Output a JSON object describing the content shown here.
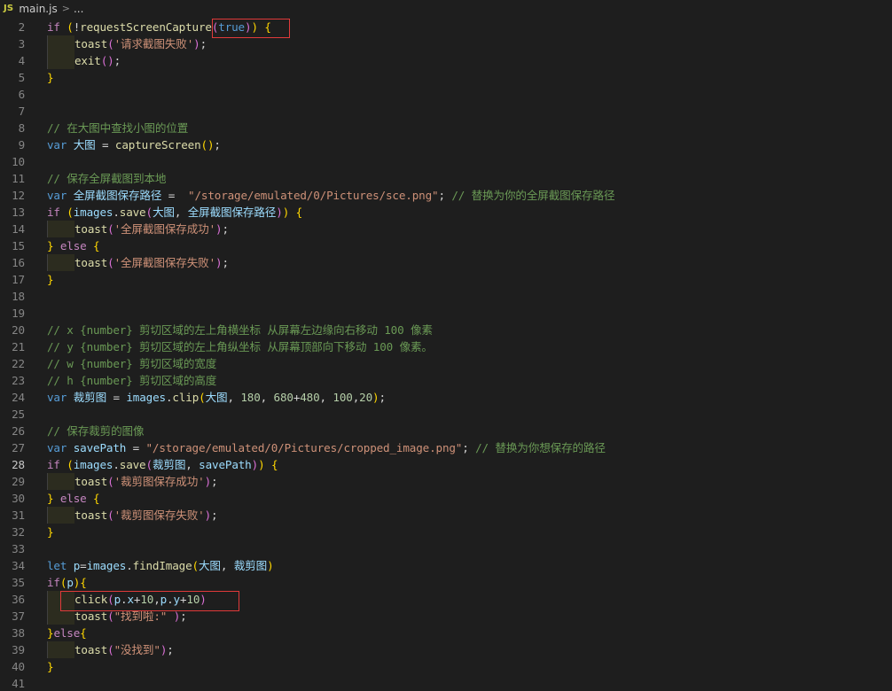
{
  "breadcrumb": {
    "lang_badge": "JS",
    "file": "main.js",
    "separator": ">",
    "more": "..."
  },
  "active_line": 28,
  "lines": [
    {
      "n": "2",
      "t": [
        [
          "ctrl",
          "if "
        ],
        [
          "br1",
          "("
        ],
        [
          "pun",
          "!"
        ],
        [
          "fn",
          "requestScreenCapture"
        ],
        [
          "br2",
          "("
        ],
        [
          "kw",
          "true"
        ],
        [
          "br2",
          ")"
        ],
        [
          "br1",
          ")"
        ],
        [
          "pun",
          " "
        ],
        [
          "br1",
          "{"
        ]
      ]
    },
    {
      "n": "3",
      "i": 1,
      "t": [
        [
          "fn",
          "toast"
        ],
        [
          "br2",
          "("
        ],
        [
          "str",
          "'请求截图失败'"
        ],
        [
          "br2",
          ")"
        ],
        [
          "pun",
          ";"
        ]
      ]
    },
    {
      "n": "4",
      "i": 1,
      "t": [
        [
          "fn",
          "exit"
        ],
        [
          "br2",
          "()"
        ],
        [
          "pun",
          ";"
        ]
      ]
    },
    {
      "n": "5",
      "t": [
        [
          "br1",
          "}"
        ]
      ]
    },
    {
      "n": "6",
      "t": []
    },
    {
      "n": "7",
      "t": []
    },
    {
      "n": "8",
      "t": [
        [
          "cm",
          "// 在大图中查找小图的位置"
        ]
      ]
    },
    {
      "n": "9",
      "t": [
        [
          "kw",
          "var "
        ],
        [
          "var",
          "大图"
        ],
        [
          "pun",
          " = "
        ],
        [
          "fn",
          "captureScreen"
        ],
        [
          "br1",
          "()"
        ],
        [
          "pun",
          ";"
        ]
      ]
    },
    {
      "n": "10",
      "t": []
    },
    {
      "n": "11",
      "t": [
        [
          "cm",
          "// 保存全屏截图到本地"
        ]
      ]
    },
    {
      "n": "12",
      "t": [
        [
          "kw",
          "var "
        ],
        [
          "var",
          "全屏截图保存路径"
        ],
        [
          "pun",
          " =  "
        ],
        [
          "str",
          "\"/storage/emulated/0/Pictures/sce.png\""
        ],
        [
          "pun",
          "; "
        ],
        [
          "cm",
          "// 替换为你的全屏截图保存路径"
        ]
      ]
    },
    {
      "n": "13",
      "t": [
        [
          "ctrl",
          "if "
        ],
        [
          "br1",
          "("
        ],
        [
          "var",
          "images"
        ],
        [
          "pun",
          "."
        ],
        [
          "fn",
          "save"
        ],
        [
          "br2",
          "("
        ],
        [
          "var",
          "大图"
        ],
        [
          "pun",
          ", "
        ],
        [
          "var",
          "全屏截图保存路径"
        ],
        [
          "br2",
          ")"
        ],
        [
          "br1",
          ")"
        ],
        [
          "pun",
          " "
        ],
        [
          "br1",
          "{"
        ]
      ]
    },
    {
      "n": "14",
      "i": 1,
      "t": [
        [
          "fn",
          "toast"
        ],
        [
          "br2",
          "("
        ],
        [
          "str",
          "'全屏截图保存成功'"
        ],
        [
          "br2",
          ")"
        ],
        [
          "pun",
          ";"
        ]
      ]
    },
    {
      "n": "15",
      "t": [
        [
          "br1",
          "}"
        ],
        [
          "pun",
          " "
        ],
        [
          "ctrl",
          "else"
        ],
        [
          "pun",
          " "
        ],
        [
          "br1",
          "{"
        ]
      ]
    },
    {
      "n": "16",
      "i": 1,
      "t": [
        [
          "fn",
          "toast"
        ],
        [
          "br2",
          "("
        ],
        [
          "str",
          "'全屏截图保存失败'"
        ],
        [
          "br2",
          ")"
        ],
        [
          "pun",
          ";"
        ]
      ]
    },
    {
      "n": "17",
      "t": [
        [
          "br1",
          "}"
        ]
      ]
    },
    {
      "n": "18",
      "t": []
    },
    {
      "n": "19",
      "t": []
    },
    {
      "n": "20",
      "t": [
        [
          "cm",
          "// x {number} 剪切区域的左上角横坐标 从屏幕左边缘向右移动 100 像素"
        ]
      ]
    },
    {
      "n": "21",
      "t": [
        [
          "cm",
          "// y {number} 剪切区域的左上角纵坐标 从屏幕顶部向下移动 100 像素。"
        ]
      ]
    },
    {
      "n": "22",
      "t": [
        [
          "cm",
          "// w {number} 剪切区域的宽度"
        ]
      ]
    },
    {
      "n": "23",
      "t": [
        [
          "cm",
          "// h {number} 剪切区域的高度"
        ]
      ]
    },
    {
      "n": "24",
      "t": [
        [
          "kw",
          "var "
        ],
        [
          "var",
          "裁剪图"
        ],
        [
          "pun",
          " = "
        ],
        [
          "var",
          "images"
        ],
        [
          "pun",
          "."
        ],
        [
          "fn",
          "clip"
        ],
        [
          "br1",
          "("
        ],
        [
          "var",
          "大图"
        ],
        [
          "pun",
          ", "
        ],
        [
          "num",
          "180"
        ],
        [
          "pun",
          ", "
        ],
        [
          "num",
          "680"
        ],
        [
          "pun",
          "+"
        ],
        [
          "num",
          "480"
        ],
        [
          "pun",
          ", "
        ],
        [
          "num",
          "100"
        ],
        [
          "pun",
          ","
        ],
        [
          "num",
          "20"
        ],
        [
          "br1",
          ")"
        ],
        [
          "pun",
          ";"
        ]
      ]
    },
    {
      "n": "25",
      "t": []
    },
    {
      "n": "26",
      "t": [
        [
          "cm",
          "// 保存裁剪的图像"
        ]
      ]
    },
    {
      "n": "27",
      "t": [
        [
          "kw",
          "var "
        ],
        [
          "var",
          "savePath"
        ],
        [
          "pun",
          " = "
        ],
        [
          "str",
          "\"/storage/emulated/0/Pictures/cropped_image.png\""
        ],
        [
          "pun",
          "; "
        ],
        [
          "cm",
          "// 替换为你想保存的路径"
        ]
      ]
    },
    {
      "n": "28",
      "t": [
        [
          "ctrl",
          "if "
        ],
        [
          "br1",
          "("
        ],
        [
          "var",
          "images"
        ],
        [
          "pun",
          "."
        ],
        [
          "fn",
          "save"
        ],
        [
          "br2",
          "("
        ],
        [
          "var",
          "裁剪图"
        ],
        [
          "pun",
          ", "
        ],
        [
          "var",
          "savePath"
        ],
        [
          "br2",
          ")"
        ],
        [
          "br1",
          ")"
        ],
        [
          "pun",
          " "
        ],
        [
          "br1",
          "{"
        ]
      ]
    },
    {
      "n": "29",
      "i": 1,
      "t": [
        [
          "fn",
          "toast"
        ],
        [
          "br2",
          "("
        ],
        [
          "str",
          "'裁剪图保存成功'"
        ],
        [
          "br2",
          ")"
        ],
        [
          "pun",
          ";"
        ]
      ]
    },
    {
      "n": "30",
      "t": [
        [
          "br1",
          "}"
        ],
        [
          "pun",
          " "
        ],
        [
          "ctrl",
          "else"
        ],
        [
          "pun",
          " "
        ],
        [
          "br1",
          "{"
        ]
      ]
    },
    {
      "n": "31",
      "i": 1,
      "t": [
        [
          "fn",
          "toast"
        ],
        [
          "br2",
          "("
        ],
        [
          "str",
          "'裁剪图保存失败'"
        ],
        [
          "br2",
          ")"
        ],
        [
          "pun",
          ";"
        ]
      ]
    },
    {
      "n": "32",
      "t": [
        [
          "br1",
          "}"
        ]
      ]
    },
    {
      "n": "33",
      "t": []
    },
    {
      "n": "34",
      "t": [
        [
          "kw",
          "let "
        ],
        [
          "var",
          "p"
        ],
        [
          "pun",
          "="
        ],
        [
          "var",
          "images"
        ],
        [
          "pun",
          "."
        ],
        [
          "fn",
          "findImage"
        ],
        [
          "br1",
          "("
        ],
        [
          "var",
          "大图"
        ],
        [
          "pun",
          ", "
        ],
        [
          "var",
          "裁剪图"
        ],
        [
          "br1",
          ")"
        ]
      ]
    },
    {
      "n": "35",
      "t": [
        [
          "ctrl",
          "if"
        ],
        [
          "br1",
          "("
        ],
        [
          "var",
          "p"
        ],
        [
          "br1",
          ")"
        ],
        [
          "br1",
          "{"
        ]
      ]
    },
    {
      "n": "36",
      "i": 1,
      "t": [
        [
          "fn",
          "click"
        ],
        [
          "br2",
          "("
        ],
        [
          "var",
          "p"
        ],
        [
          "pun",
          "."
        ],
        [
          "var",
          "x"
        ],
        [
          "pun",
          "+"
        ],
        [
          "num",
          "10"
        ],
        [
          "pun",
          ","
        ],
        [
          "var",
          "p"
        ],
        [
          "pun",
          "."
        ],
        [
          "var",
          "y"
        ],
        [
          "pun",
          "+"
        ],
        [
          "num",
          "10"
        ],
        [
          "br2",
          ")"
        ]
      ]
    },
    {
      "n": "37",
      "i": 1,
      "t": [
        [
          "fn",
          "toast"
        ],
        [
          "br2",
          "("
        ],
        [
          "str",
          "\"找到啦:\""
        ],
        [
          "pun",
          " "
        ],
        [
          "br2",
          ")"
        ],
        [
          "pun",
          ";"
        ]
      ]
    },
    {
      "n": "38",
      "t": [
        [
          "br1",
          "}"
        ],
        [
          "ctrl",
          "else"
        ],
        [
          "br1",
          "{"
        ]
      ]
    },
    {
      "n": "39",
      "i": 1,
      "t": [
        [
          "fn",
          "toast"
        ],
        [
          "br2",
          "("
        ],
        [
          "str",
          "\"没找到\""
        ],
        [
          "br2",
          ")"
        ],
        [
          "pun",
          ";"
        ]
      ]
    },
    {
      "n": "40",
      "t": [
        [
          "br1",
          "}"
        ]
      ]
    },
    {
      "n": "41",
      "t": []
    }
  ]
}
